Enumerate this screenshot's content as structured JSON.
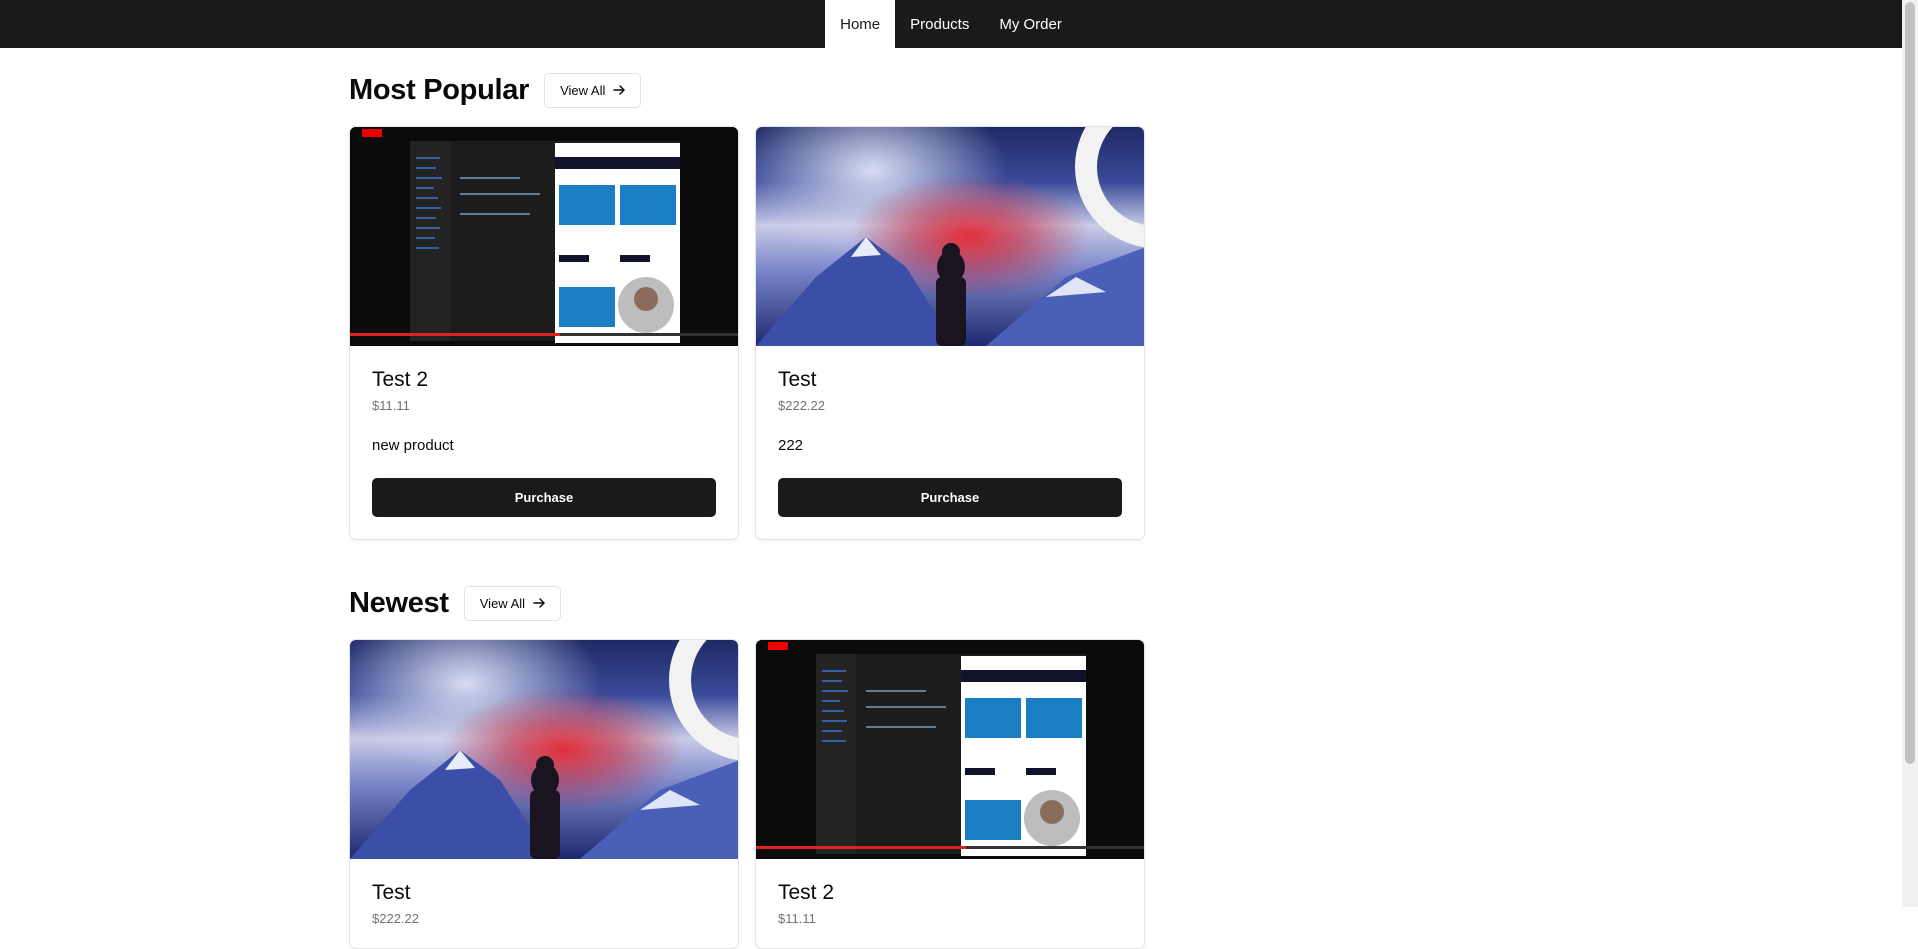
{
  "nav": {
    "items": [
      {
        "label": "Home",
        "active": true
      },
      {
        "label": "Products",
        "active": false
      },
      {
        "label": "My Order",
        "active": false
      }
    ]
  },
  "sections": [
    {
      "title": "Most Popular",
      "view_all_label": "View All",
      "products": [
        {
          "name": "Test 2",
          "price": "$11.11",
          "description": "new product",
          "button_label": "Purchase",
          "image": "video-screenshot"
        },
        {
          "name": "Test",
          "price": "$222.22",
          "description": "222",
          "button_label": "Purchase",
          "image": "mountain-art"
        }
      ]
    },
    {
      "title": "Newest",
      "view_all_label": "View All",
      "products": [
        {
          "name": "Test",
          "price": "$222.22",
          "image": "mountain-art"
        },
        {
          "name": "Test 2",
          "price": "$11.11",
          "image": "video-screenshot"
        }
      ]
    }
  ],
  "colors": {
    "nav_bg": "#1a1a1a",
    "button_bg": "#1a1a1a",
    "muted_text": "#737373"
  }
}
